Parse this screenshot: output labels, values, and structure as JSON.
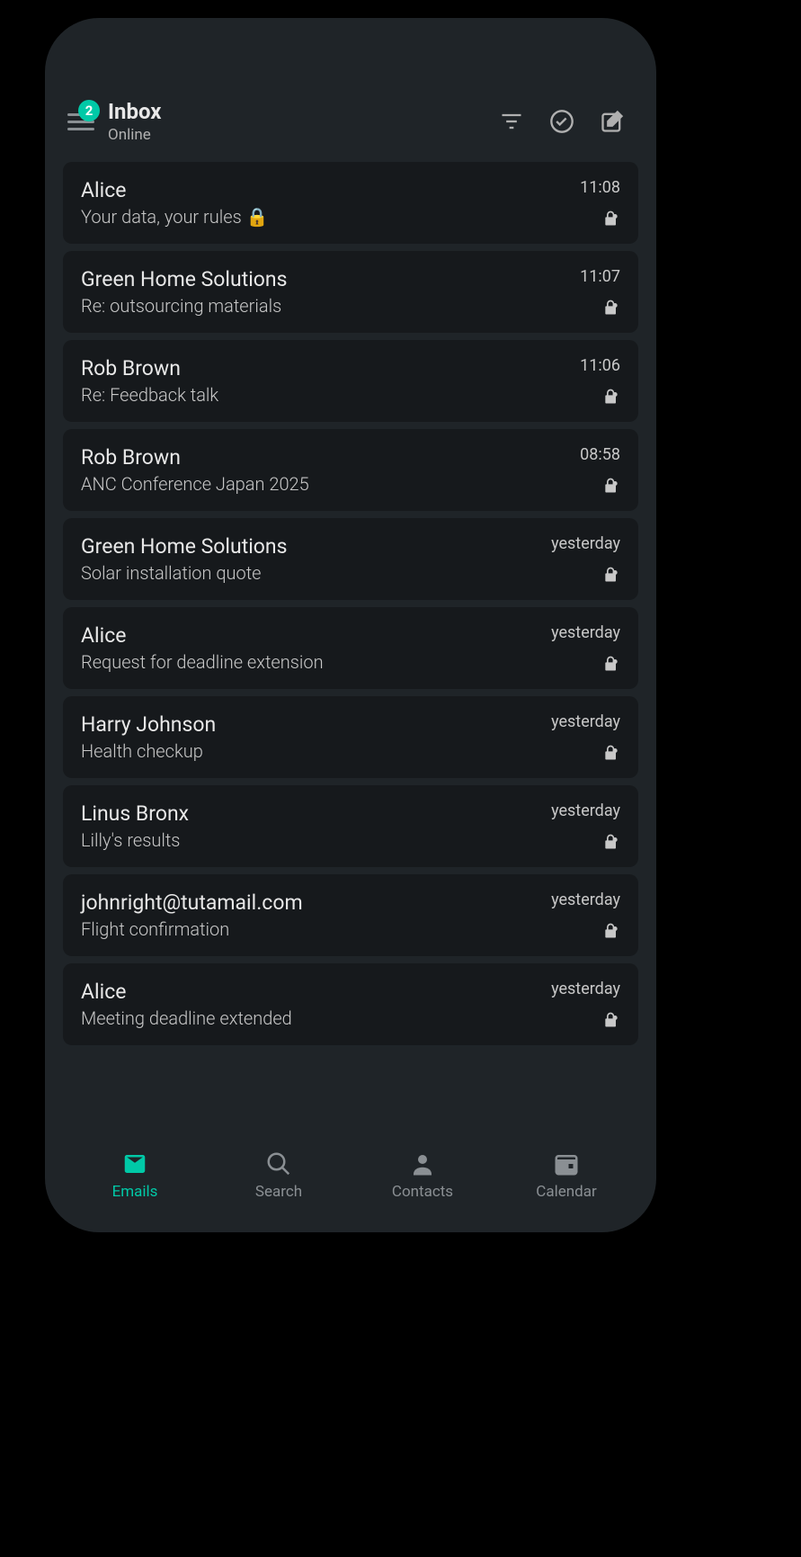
{
  "header": {
    "title": "Inbox",
    "status": "Online",
    "badge": "2"
  },
  "emails": [
    {
      "sender": "Alice",
      "subject": "Your data, your rules 🔒",
      "time": "11:08"
    },
    {
      "sender": "Green Home Solutions",
      "subject": "Re: outsourcing materials",
      "time": "11:07"
    },
    {
      "sender": "Rob Brown",
      "subject": "Re: Feedback talk",
      "time": "11:06"
    },
    {
      "sender": "Rob Brown",
      "subject": "ANC Conference Japan 2025",
      "time": "08:58"
    },
    {
      "sender": "Green Home Solutions",
      "subject": "Solar installation quote",
      "time": "yesterday"
    },
    {
      "sender": "Alice",
      "subject": "Request for deadline extension",
      "time": "yesterday"
    },
    {
      "sender": "Harry Johnson",
      "subject": "Health checkup",
      "time": "yesterday"
    },
    {
      "sender": "Linus Bronx",
      "subject": "Lilly's results",
      "time": "yesterday"
    },
    {
      "sender": "johnright@tutamail.com",
      "subject": "Flight confirmation",
      "time": "yesterday"
    },
    {
      "sender": "Alice",
      "subject": "Meeting deadline extended",
      "time": "yesterday"
    }
  ],
  "nav": {
    "emails": "Emails",
    "search": "Search",
    "contacts": "Contacts",
    "calendar": "Calendar"
  }
}
